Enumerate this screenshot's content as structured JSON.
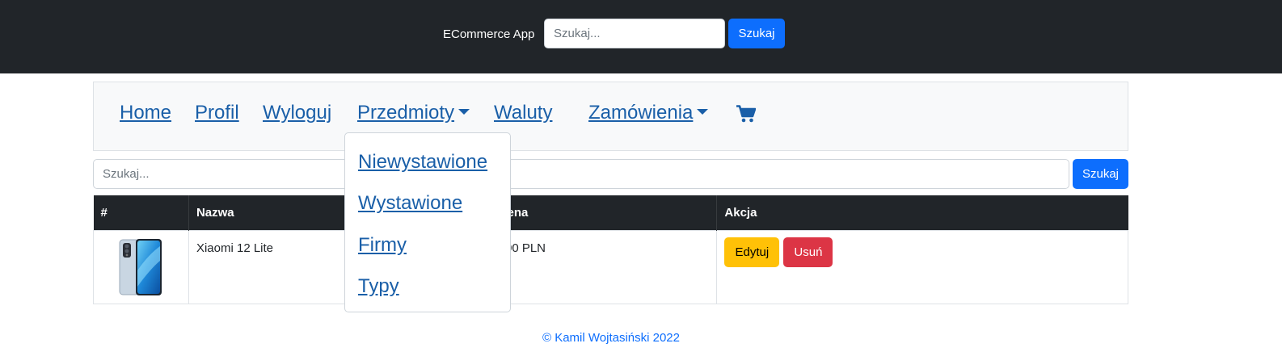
{
  "header": {
    "brand": "ECommerce App",
    "search_placeholder": "Szukaj...",
    "search_button": "Szukaj"
  },
  "nav": {
    "items": [
      "Home",
      "Profil",
      "Wyloguj",
      "Przedmioty",
      "Waluty",
      "Zamówienia"
    ],
    "cart_icon": "cart-icon"
  },
  "dropdown": {
    "items": [
      "Niewystawione",
      "Wystawione",
      "Firmy",
      "Typy"
    ]
  },
  "search": {
    "placeholder": "Szukaj...",
    "button": "Szukaj"
  },
  "table": {
    "headers": [
      "#",
      "Nazwa",
      "Cena",
      "Akcja"
    ],
    "rows": [
      {
        "image": "phone-image",
        "name": "Xiaomi 12 Lite",
        "price": "200 PLN",
        "edit": "Edytuj",
        "delete": "Usuń"
      }
    ]
  },
  "footer": {
    "text": "© Kamil Wojtasiński 2022"
  },
  "colors": {
    "topbar": "#212529",
    "primary": "#0d6efd",
    "warning": "#ffc107",
    "danger": "#dc3545",
    "link": "#1a5fa8"
  }
}
